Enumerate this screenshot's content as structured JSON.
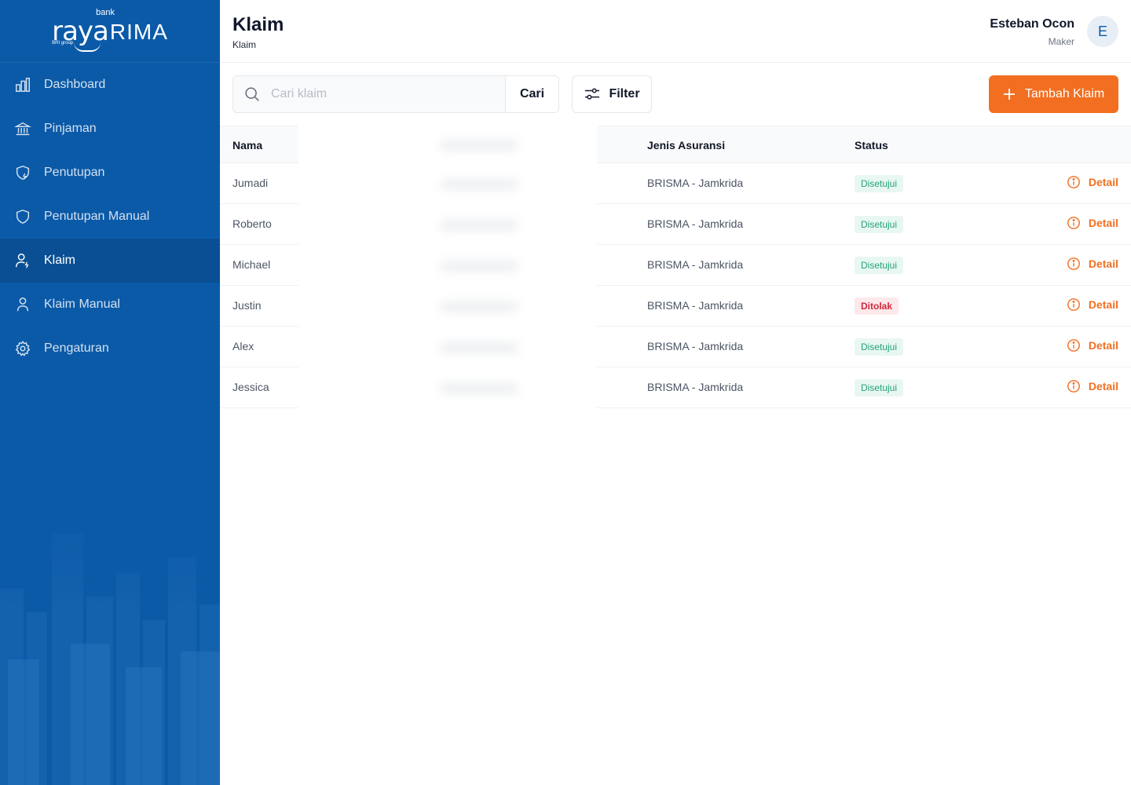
{
  "brand": {
    "bank": "bank",
    "raya": "raya",
    "rima": "RIMA",
    "group": "BRI group"
  },
  "sidebar": {
    "items": [
      {
        "label": "Dashboard",
        "icon": "chart-icon",
        "active": false
      },
      {
        "label": "Pinjaman",
        "icon": "bank-icon",
        "active": false
      },
      {
        "label": "Penutupan",
        "icon": "shield-bolt-icon",
        "active": false
      },
      {
        "label": "Penutupan Manual",
        "icon": "shield-icon",
        "active": false
      },
      {
        "label": "Klaim",
        "icon": "user-bolt-icon",
        "active": true
      },
      {
        "label": "Klaim Manual",
        "icon": "user-icon",
        "active": false
      },
      {
        "label": "Pengaturan",
        "icon": "gear-icon",
        "active": false
      }
    ]
  },
  "header": {
    "title": "Klaim",
    "breadcrumb": "Klaim",
    "user_name": "Esteban Ocon",
    "user_role": "Maker",
    "avatar_initial": "E"
  },
  "toolbar": {
    "search_placeholder": "Cari klaim",
    "search_button": "Cari",
    "filter_button": "Filter",
    "add_button": "Tambah Klaim"
  },
  "table": {
    "columns": [
      "Nama",
      "Jenis Asuransi",
      "Status"
    ],
    "action_label": "Detail",
    "rows": [
      {
        "nama": "Jumadi",
        "jenis": "BRISMA - Jamkrida",
        "status": "Disetujui",
        "type": "ok"
      },
      {
        "nama": "Roberto",
        "jenis": "BRISMA - Jamkrida",
        "status": "Disetujui",
        "type": "ok"
      },
      {
        "nama": "Michael",
        "jenis": "BRISMA - Jamkrida",
        "status": "Disetujui",
        "type": "ok"
      },
      {
        "nama": "Justin",
        "jenis": "BRISMA - Jamkrida",
        "status": "Ditolak",
        "type": "rej"
      },
      {
        "nama": "Alex",
        "jenis": "BRISMA - Jamkrida",
        "status": "Disetujui",
        "type": "ok"
      },
      {
        "nama": "Jessica",
        "jenis": "BRISMA - Jamkrida",
        "status": "Disetujui",
        "type": "ok"
      }
    ]
  },
  "colors": {
    "sidebar": "#0b5aa8",
    "accent": "#f26f21",
    "approved": "#22a37a",
    "rejected": "#d1293d"
  }
}
